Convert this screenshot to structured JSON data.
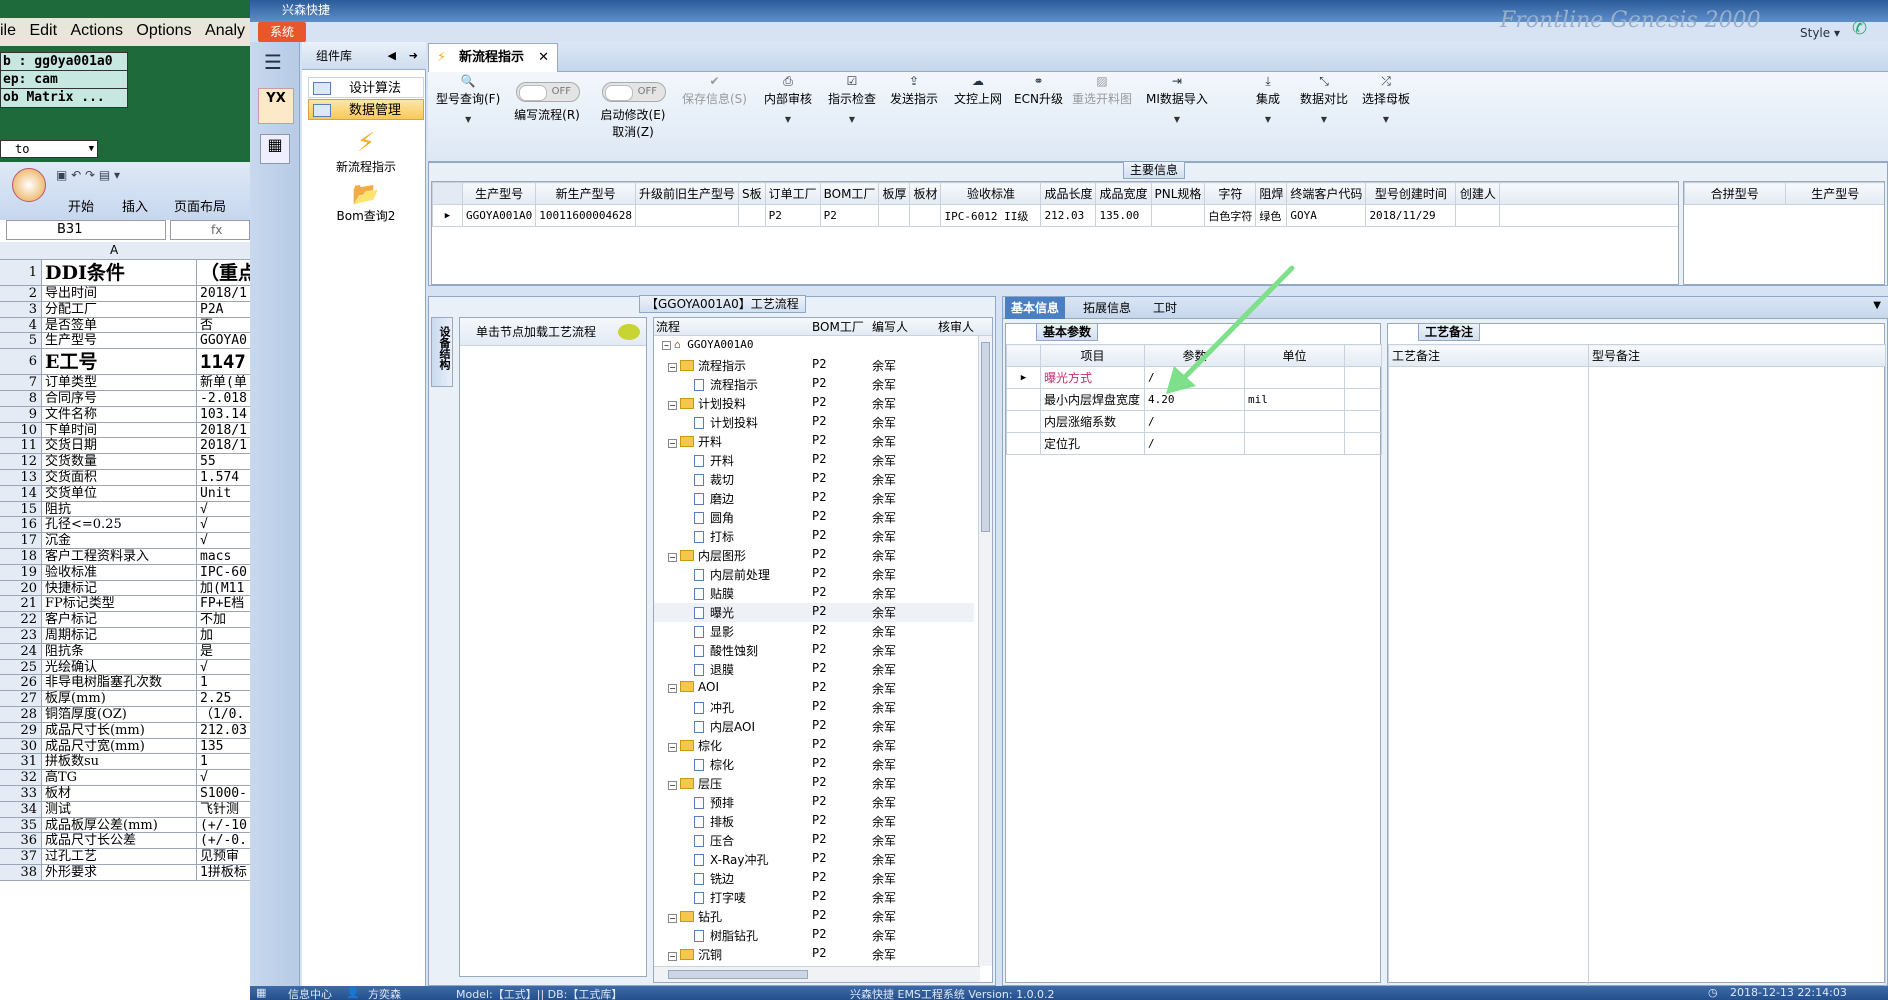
{
  "left_app": {
    "menu": [
      "ile",
      "Edit",
      "Actions",
      "Options",
      "Analy"
    ],
    "fields": [
      "b : gg0ya001a0",
      "ep: cam",
      "ob Matrix ..."
    ],
    "select_value": "to"
  },
  "excel": {
    "tabs": [
      "开始",
      "插入",
      "页面布局"
    ],
    "name_box": "B31",
    "fx": "fx",
    "col_a": "A",
    "rows": [
      {
        "n": "1",
        "a": "DDI条件",
        "b": "（重点"
      },
      {
        "n": "2",
        "a": "导出时间",
        "b": "2018/1"
      },
      {
        "n": "3",
        "a": "分配工厂",
        "b": "P2A"
      },
      {
        "n": "4",
        "a": "是否签单",
        "b": "否"
      },
      {
        "n": "5",
        "a": "生产型号",
        "b": "GGOYA0"
      },
      {
        "n": "6",
        "a": "E工号",
        "b": "1147"
      },
      {
        "n": "7",
        "a": "订单类型",
        "b": "新单(单"
      },
      {
        "n": "8",
        "a": "合同序号",
        "b": "-2.018"
      },
      {
        "n": "9",
        "a": "文件名称",
        "b": "103.14"
      },
      {
        "n": "10",
        "a": "下单时间",
        "b": "2018/1"
      },
      {
        "n": "11",
        "a": "交货日期",
        "b": "2018/1"
      },
      {
        "n": "12",
        "a": "交货数量",
        "b": "55"
      },
      {
        "n": "13",
        "a": "交货面积",
        "b": "1.574"
      },
      {
        "n": "14",
        "a": "交货单位",
        "b": "Unit"
      },
      {
        "n": "15",
        "a": "阻抗",
        "b": "√"
      },
      {
        "n": "16",
        "a": "孔径<=0.25",
        "b": "√"
      },
      {
        "n": "17",
        "a": "沉金",
        "b": "√"
      },
      {
        "n": "18",
        "a": "客户工程资料录入",
        "b": "macs"
      },
      {
        "n": "19",
        "a": "验收标准",
        "b": "IPC-60"
      },
      {
        "n": "20",
        "a": "快捷标记",
        "b": "加(M11"
      },
      {
        "n": "21",
        "a": "FP标记类型",
        "b": "FP+E档"
      },
      {
        "n": "22",
        "a": "客户标记",
        "b": "不加"
      },
      {
        "n": "23",
        "a": "周期标记",
        "b": "加"
      },
      {
        "n": "24",
        "a": "阻抗条",
        "b": "是"
      },
      {
        "n": "25",
        "a": "光绘确认",
        "b": "√"
      },
      {
        "n": "26",
        "a": "非导电树脂塞孔次数",
        "b": "1"
      },
      {
        "n": "27",
        "a": "板厚(mm)",
        "b": "2.25"
      },
      {
        "n": "28",
        "a": "铜箔厚度(OZ)",
        "b": "（1/0."
      },
      {
        "n": "29",
        "a": "成品尺寸长(mm)",
        "b": "212.03"
      },
      {
        "n": "30",
        "a": "成品尺寸宽(mm)",
        "b": "135"
      },
      {
        "n": "31",
        "a": "拼板数su",
        "b": "1"
      },
      {
        "n": "32",
        "a": "高TG",
        "b": "√"
      },
      {
        "n": "33",
        "a": "板材",
        "b": "S1000-"
      },
      {
        "n": "34",
        "a": "测试",
        "b": "飞针测"
      },
      {
        "n": "35",
        "a": "成品板厚公差(mm)",
        "b": "(+/-10"
      },
      {
        "n": "36",
        "a": "成品尺寸长公差",
        "b": "(+/-0."
      },
      {
        "n": "37",
        "a": "过孔工艺",
        "b": "见预审"
      },
      {
        "n": "38",
        "a": "外形要求",
        "b": "1拼板标"
      }
    ]
  },
  "app": {
    "top_label": "兴森快捷",
    "system_button": "系统",
    "brand": "Frontline Genesis 2000",
    "style_label": "Style ▾",
    "nav_logo": "YX",
    "library": {
      "title": "组件库",
      "items": [
        "设计算法",
        "数据管理"
      ],
      "icons": [
        "新流程指示",
        "Bom查询2"
      ]
    },
    "doc_tab": "新流程指示",
    "toolbar": [
      {
        "label": "型号查询(F)",
        "icon": "magnifier"
      },
      {
        "label": "编写流程(R)",
        "icon": "toggle",
        "toggle": "OFF"
      },
      {
        "label": "启动修改(E)",
        "icon": "toggle",
        "toggle": "OFF",
        "sub": "取消(Z)"
      },
      {
        "label": "保存信息(S)",
        "icon": "check"
      },
      {
        "label": "内部审核",
        "icon": "printer"
      },
      {
        "label": "指示检查",
        "icon": "checkbox"
      },
      {
        "label": "发送指示",
        "icon": "upload"
      },
      {
        "label": "文控上网",
        "icon": "cloud"
      },
      {
        "label": "ECN升级",
        "icon": "binoculars"
      },
      {
        "label": "重选开料图",
        "icon": "image"
      },
      {
        "label": "MI数据导入",
        "icon": "import"
      },
      {
        "label": "集成",
        "icon": "download"
      },
      {
        "label": "数据对比",
        "icon": "compare"
      },
      {
        "label": "选择母板",
        "icon": "shuffle"
      }
    ],
    "main_info": {
      "title": "主要信息",
      "columns": [
        "生产型号",
        "新生产型号",
        "升级前旧生产型号",
        "S板",
        "订单工厂",
        "BOM工厂",
        "板厚",
        "板材",
        "验收标准",
        "成品长度",
        "成品宽度",
        "PNL规格",
        "字符",
        "阻焊",
        "终端客户代码",
        "型号创建时间",
        "创建人"
      ],
      "row": [
        "GGOYA001A0",
        "10011600004628",
        "",
        "",
        "P2",
        "P2",
        "",
        "",
        "IPC-6012 II级",
        "212.03",
        "135.00",
        "",
        "白色字符",
        "绿色",
        "GOYA",
        "2018/11/29",
        ""
      ],
      "merge_columns": [
        "合拼型号",
        "生产型号"
      ]
    },
    "process": {
      "title": "【GGOYA001A0】工艺流程",
      "side_tab": "设备结构",
      "hint": "单击节点加载工艺流程",
      "columns": [
        "流程",
        "BOM工厂",
        "编写人",
        "核审人"
      ],
      "root": "GGOYA001A0",
      "nodes": [
        {
          "name": "流程指示",
          "level": 1,
          "bom": "P2",
          "by": "余军"
        },
        {
          "name": "流程指示",
          "level": 2,
          "bom": "P2",
          "by": "余军"
        },
        {
          "name": "计划投料",
          "level": 1,
          "bom": "P2",
          "by": "余军"
        },
        {
          "name": "计划投料",
          "level": 2,
          "bom": "P2",
          "by": "余军"
        },
        {
          "name": "开料",
          "level": 1,
          "bom": "P2",
          "by": "余军"
        },
        {
          "name": "开料",
          "level": 2,
          "bom": "P2",
          "by": "余军"
        },
        {
          "name": "裁切",
          "level": 2,
          "bom": "P2",
          "by": "余军"
        },
        {
          "name": "磨边",
          "level": 2,
          "bom": "P2",
          "by": "余军"
        },
        {
          "name": "圆角",
          "level": 2,
          "bom": "P2",
          "by": "余军"
        },
        {
          "name": "打标",
          "level": 2,
          "bom": "P2",
          "by": "余军"
        },
        {
          "name": "内层图形",
          "level": 1,
          "bom": "P2",
          "by": "余军"
        },
        {
          "name": "内层前处理",
          "level": 2,
          "bom": "P2",
          "by": "余军"
        },
        {
          "name": "贴膜",
          "level": 2,
          "bom": "P2",
          "by": "余军"
        },
        {
          "name": "曝光",
          "level": 2,
          "bom": "P2",
          "by": "余军"
        },
        {
          "name": "显影",
          "level": 2,
          "bom": "P2",
          "by": "余军"
        },
        {
          "name": "酸性蚀刻",
          "level": 2,
          "bom": "P2",
          "by": "余军"
        },
        {
          "name": "退膜",
          "level": 2,
          "bom": "P2",
          "by": "余军"
        },
        {
          "name": "AOI",
          "level": 1,
          "bom": "P2",
          "by": "余军"
        },
        {
          "name": "冲孔",
          "level": 2,
          "bom": "P2",
          "by": "余军"
        },
        {
          "name": "内层AOI",
          "level": 2,
          "bom": "P2",
          "by": "余军"
        },
        {
          "name": "棕化",
          "level": 1,
          "bom": "P2",
          "by": "余军"
        },
        {
          "name": "棕化",
          "level": 2,
          "bom": "P2",
          "by": "余军"
        },
        {
          "name": "层压",
          "level": 1,
          "bom": "P2",
          "by": "余军"
        },
        {
          "name": "预排",
          "level": 2,
          "bom": "P2",
          "by": "余军"
        },
        {
          "name": "排板",
          "level": 2,
          "bom": "P2",
          "by": "余军"
        },
        {
          "name": "压合",
          "level": 2,
          "bom": "P2",
          "by": "余军"
        },
        {
          "name": "X-Ray冲孔",
          "level": 2,
          "bom": "P2",
          "by": "余军"
        },
        {
          "name": "铣边",
          "level": 2,
          "bom": "P2",
          "by": "余军"
        },
        {
          "name": "打字唛",
          "level": 2,
          "bom": "P2",
          "by": "余军"
        },
        {
          "name": "钻孔",
          "level": 1,
          "bom": "P2",
          "by": "余军"
        },
        {
          "name": "树脂钻孔",
          "level": 2,
          "bom": "P2",
          "by": "余军"
        },
        {
          "name": "沉铜",
          "level": 1,
          "bom": "P2",
          "by": "余军"
        }
      ]
    },
    "detail_tabs": [
      "基本信息",
      "拓展信息",
      "工时"
    ],
    "basic_params": {
      "title": "基本参数",
      "columns": [
        "项目",
        "参数",
        "单位"
      ],
      "rows": [
        {
          "item": "曝光方式",
          "value": "/",
          "unit": ""
        },
        {
          "item": "最小内层焊盘宽度",
          "value": "4.20",
          "unit": "mil"
        },
        {
          "item": "内层涨缩系数",
          "value": "/",
          "unit": ""
        },
        {
          "item": "定位孔",
          "value": "/",
          "unit": ""
        }
      ]
    },
    "process_notes": {
      "title": "工艺备注",
      "columns": [
        "工艺备注",
        "型号备注"
      ]
    },
    "status": {
      "info_center": "信息中心",
      "user": "方奕森",
      "model": "Model:【工式】|| DB:【工式库】",
      "version": "兴森快捷 EMS工程系统 Version: 1.0.0.2",
      "datetime": "2018-12-13 22:14:03"
    },
    "accent_color": "#4a90d9",
    "arrow_color": "#7ee08a"
  }
}
